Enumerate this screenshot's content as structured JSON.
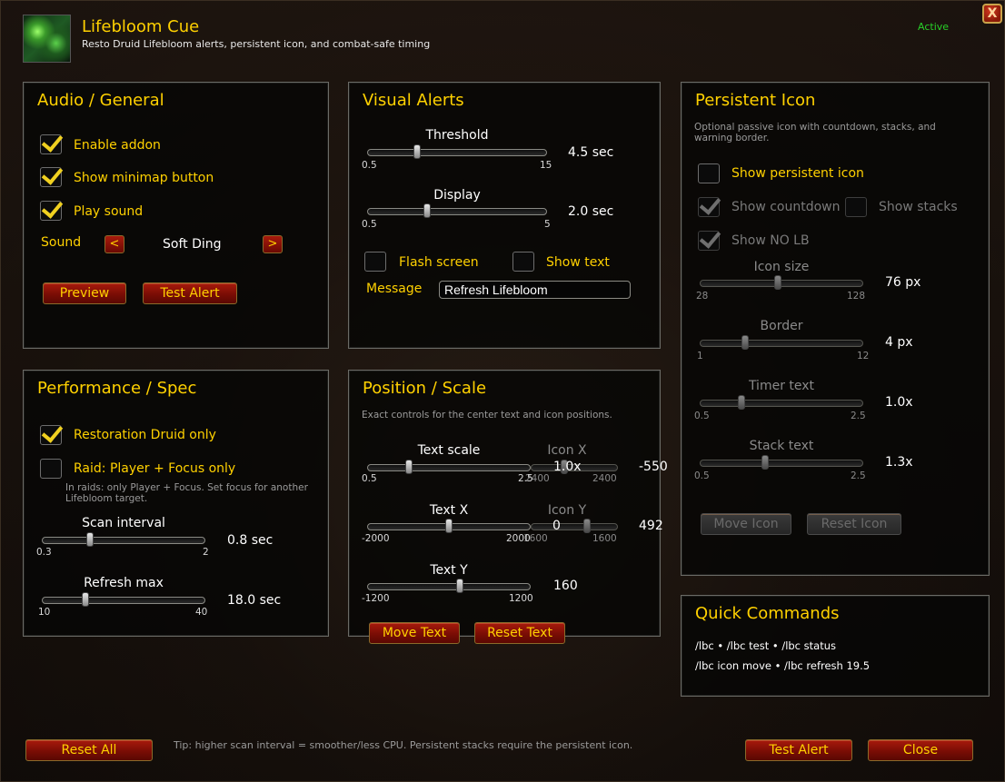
{
  "header": {
    "title": "Lifebloom Cue",
    "subtitle": "Resto Druid Lifebloom alerts, persistent icon, and combat-safe timing",
    "status": "Active",
    "close_glyph": "X",
    "logo_icon": "lifebloom-spell-icon"
  },
  "audio": {
    "title": "Audio / General",
    "enable_addon": {
      "label": "Enable addon",
      "checked": true
    },
    "show_minimap": {
      "label": "Show minimap button",
      "checked": true
    },
    "play_sound": {
      "label": "Play sound",
      "checked": true
    },
    "sound_label": "Sound",
    "sound_prev": "<",
    "sound_next": ">",
    "sound_value": "Soft Ding",
    "preview_label": "Preview",
    "test_alert_label": "Test Alert"
  },
  "visual": {
    "title": "Visual Alerts",
    "threshold": {
      "label": "Threshold",
      "min": "0.5",
      "max": "15",
      "value": 4.5,
      "display": "4.5 sec",
      "lo": 0.5,
      "hi": 15
    },
    "display": {
      "label": "Display",
      "min": "0.5",
      "max": "5",
      "value": 2.0,
      "display": "2.0 sec",
      "lo": 0.5,
      "hi": 5
    },
    "flash_screen": {
      "label": "Flash screen",
      "checked": false
    },
    "show_text": {
      "label": "Show text",
      "checked": false
    },
    "message_label": "Message",
    "message_value": "Refresh Lifebloom"
  },
  "persistent": {
    "title": "Persistent Icon",
    "description": "Optional passive icon with countdown, stacks, and warning border.",
    "show_icon": {
      "label": "Show persistent icon",
      "checked": false
    },
    "show_countdown": {
      "label": "Show countdown",
      "checked": true
    },
    "show_stacks": {
      "label": "Show stacks",
      "checked": false
    },
    "show_no_lb": {
      "label": "Show NO LB",
      "checked": true
    },
    "icon_size": {
      "label": "Icon size",
      "min": "28",
      "max": "128",
      "value": 76,
      "display": "76 px",
      "lo": 28,
      "hi": 128
    },
    "border": {
      "label": "Border",
      "min": "1",
      "max": "12",
      "value": 4,
      "display": "4 px",
      "lo": 1,
      "hi": 12
    },
    "timer_text": {
      "label": "Timer text",
      "min": "0.5",
      "max": "2.5",
      "value": 1.0,
      "display": "1.0x",
      "lo": 0.5,
      "hi": 2.5
    },
    "stack_text": {
      "label": "Stack text",
      "min": "0.5",
      "max": "2.5",
      "value": 1.3,
      "display": "1.3x",
      "lo": 0.5,
      "hi": 2.5
    },
    "move_icon_label": "Move Icon",
    "reset_icon_label": "Reset Icon"
  },
  "performance": {
    "title": "Performance / Spec",
    "resto_only": {
      "label": "Restoration Druid only",
      "checked": true
    },
    "raid_player_focus": {
      "label": "Raid: Player + Focus only",
      "checked": false
    },
    "raid_note": "In raids: only Player + Focus. Set focus for another Lifebloom target.",
    "scan_interval": {
      "label": "Scan interval",
      "min": "0.3",
      "max": "2",
      "value": 0.8,
      "display": "0.8 sec",
      "lo": 0.3,
      "hi": 2
    },
    "refresh_max": {
      "label": "Refresh max",
      "min": "10",
      "max": "40",
      "value": 18.0,
      "display": "18.0 sec",
      "lo": 10,
      "hi": 40
    }
  },
  "position": {
    "title": "Position / Scale",
    "description": "Exact controls for the center text and icon positions.",
    "text_scale": {
      "label": "Text scale",
      "min": "0.5",
      "max": "2.5",
      "value": 1.0,
      "display": "1.0x",
      "lo": 0.5,
      "hi": 2.5
    },
    "icon_x": {
      "label": "Icon X",
      "min": "2400",
      "max": "2400",
      "value": -550,
      "display": "-550",
      "lo": -2400,
      "hi": 2400
    },
    "text_x": {
      "label": "Text X",
      "min": "-2000",
      "max": "2000",
      "value": 0,
      "display": "0",
      "lo": -2000,
      "hi": 2000
    },
    "icon_y": {
      "label": "Icon Y",
      "min": "1600",
      "max": "1600",
      "value": 492,
      "display": "492",
      "lo": -1600,
      "hi": 1600
    },
    "text_y": {
      "label": "Text Y",
      "min": "-1200",
      "max": "1200",
      "value": 160,
      "display": "160",
      "lo": -1200,
      "hi": 1200
    },
    "move_text_label": "Move Text",
    "reset_text_label": "Reset Text"
  },
  "commands": {
    "title": "Quick Commands",
    "line1": "/lbc  •  /lbc test  •  /lbc status",
    "line2": "/lbc icon move  •  /lbc refresh 19.5"
  },
  "footer": {
    "reset_all_label": "Reset All",
    "tip": "Tip: higher scan interval = smoother/less CPU. Persistent stacks require the persistent icon.",
    "test_alert_label": "Test Alert",
    "close_label": "Close"
  },
  "colors": {
    "accent_gold": "#ffd100",
    "status_green": "#28d028",
    "button_red": "#8a0d05"
  }
}
